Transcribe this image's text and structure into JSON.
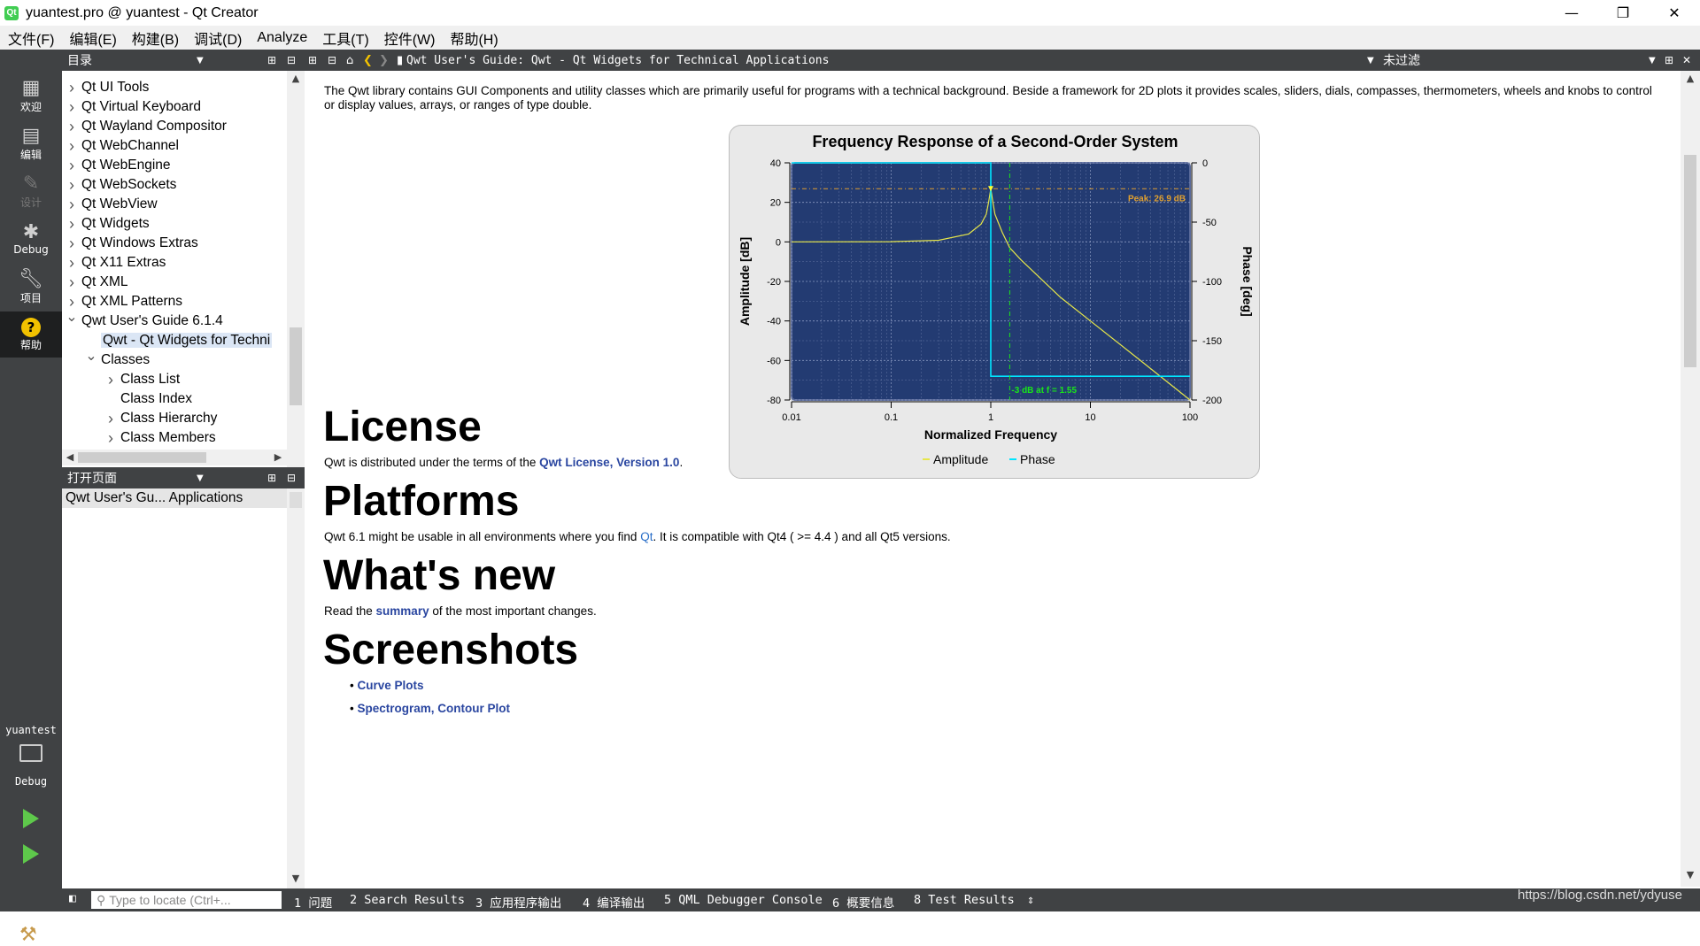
{
  "window": {
    "title": "yuantest.pro @ yuantest - Qt Creator",
    "app_icon": "Qt",
    "minimize": "—",
    "maximize": "❐",
    "close": "✕"
  },
  "menu": [
    "文件(F)",
    "编辑(E)",
    "构建(B)",
    "调试(D)",
    "Analyze",
    "工具(T)",
    "控件(W)",
    "帮助(H)"
  ],
  "modes": [
    {
      "label": "欢迎",
      "icon": "grid-icon"
    },
    {
      "label": "编辑",
      "icon": "edit-icon"
    },
    {
      "label": "设计",
      "icon": "pencil-icon"
    },
    {
      "label": "Debug",
      "icon": "bug-icon"
    },
    {
      "label": "项目",
      "icon": "wrench-icon"
    },
    {
      "label": "帮助",
      "icon": "help-icon"
    }
  ],
  "kit": {
    "project": "yuantest",
    "mode": "Debug"
  },
  "sidebar": {
    "contents_title": "目录",
    "tree": [
      {
        "label": "Qt UI Tools",
        "arrow": ">"
      },
      {
        "label": "Qt Virtual Keyboard",
        "arrow": ">"
      },
      {
        "label": "Qt Wayland Compositor",
        "arrow": ">"
      },
      {
        "label": "Qt WebChannel",
        "arrow": ">"
      },
      {
        "label": "Qt WebEngine",
        "arrow": ">"
      },
      {
        "label": "Qt WebSockets",
        "arrow": ">"
      },
      {
        "label": "Qt WebView",
        "arrow": ">"
      },
      {
        "label": "Qt Widgets",
        "arrow": ">"
      },
      {
        "label": "Qt Windows Extras",
        "arrow": ">"
      },
      {
        "label": "Qt X11 Extras",
        "arrow": ">"
      },
      {
        "label": "Qt XML",
        "arrow": ">"
      },
      {
        "label": "Qt XML Patterns",
        "arrow": ">"
      },
      {
        "label": "Qwt User's Guide 6.1.4",
        "arrow": "v"
      },
      {
        "label": "Qwt - Qt Widgets for Techni",
        "arrow": ""
      },
      {
        "label": "Classes",
        "arrow": "v"
      },
      {
        "label": "Class List",
        "arrow": ">"
      },
      {
        "label": "Class Index",
        "arrow": ""
      },
      {
        "label": "Class Hierarchy",
        "arrow": ">"
      },
      {
        "label": "Class Members",
        "arrow": ">"
      }
    ],
    "open_pages_title": "打开页面",
    "open_pages": [
      "Qwt User's Gu... Applications"
    ]
  },
  "doc_toolbar": {
    "page_title": "Qwt User's Guide: Qwt - Qt Widgets for Technical Applications",
    "filter": "未过滤"
  },
  "doc": {
    "intro": "The Qwt library contains GUI Components and utility classes which are primarily useful for programs with a technical background. Beside a framework for 2D plots it provides scales, sliders, dials, compasses, thermometers, wheels and knobs to control or display values, arrays, or ranges of type double.",
    "license_h": "License",
    "license_pre": "Qwt is distributed under the terms of the ",
    "license_link": "Qwt License, Version 1.0",
    "license_post": ".",
    "platforms_h": "Platforms",
    "platforms_pre": "Qwt 6.1 might be usable in all environments where you find ",
    "platforms_link": "Qt",
    "platforms_post": ". It is compatible with Qt4 ( >= 4.4 ) and all Qt5 versions.",
    "new_h": "What's new",
    "new_pre": "Read the ",
    "new_link": "summary",
    "new_post": " of the most important changes.",
    "shots_h": "Screenshots",
    "shots": [
      "Curve Plots",
      "Spectrogram, Contour Plot"
    ]
  },
  "chart_data": {
    "type": "line",
    "title": "Frequency Response of a Second-Order System",
    "xlabel": "Normalized Frequency",
    "ylabel": "Amplitude [dB]",
    "y2label": "Phase [deg]",
    "xscale": "log",
    "xlim": [
      0.01,
      100
    ],
    "ylim": [
      -80,
      40
    ],
    "y2lim": [
      -200,
      0
    ],
    "xticks": [
      "0.01",
      "0.1",
      "1",
      "10",
      "100"
    ],
    "yticks": [
      "40",
      "20",
      "0",
      "-20",
      "-40",
      "-60",
      "-80"
    ],
    "y2ticks": [
      "0",
      "-50",
      "-100",
      "-150",
      "-200"
    ],
    "grid": true,
    "legend_position": "bottom",
    "series": [
      {
        "name": "Amplitude",
        "axis": "left",
        "color": "#e6e64a",
        "x": [
          0.01,
          0.1,
          0.3,
          0.6,
          0.8,
          0.9,
          0.95,
          1.0,
          1.05,
          1.1,
          1.3,
          1.55,
          2,
          5,
          10,
          30,
          100
        ],
        "y": [
          0,
          0.1,
          0.8,
          4,
          9,
          14,
          20,
          26.9,
          20,
          14,
          5,
          -3,
          -9,
          -28,
          -40,
          -59,
          -80
        ]
      },
      {
        "name": "Phase",
        "axis": "right",
        "color": "#00e5ff",
        "x": [
          0.01,
          0.999,
          1.0,
          1.001,
          100
        ],
        "y": [
          0,
          0,
          -90,
          -180,
          -180
        ]
      }
    ],
    "annotations": [
      {
        "text": "Peak: 26.9 dB",
        "x": 1.0,
        "y": 26.9,
        "color": "#e0a030"
      },
      {
        "text": "-3 dB at f = 1.55",
        "x": 1.55,
        "y": -80,
        "color": "#19e619"
      }
    ],
    "background": "#233b72",
    "grid_color": "#8898c0"
  },
  "statusbar": {
    "locate_placeholder": "Type to locate (Ctrl+...",
    "panes": [
      "1 问题",
      "2 Search Results",
      "3 应用程序输出",
      "4 编译输出",
      "5 QML Debugger Console",
      "6 概要信息",
      "8 Test Results"
    ],
    "watermark": "https://blog.csdn.net/ydyuse"
  }
}
